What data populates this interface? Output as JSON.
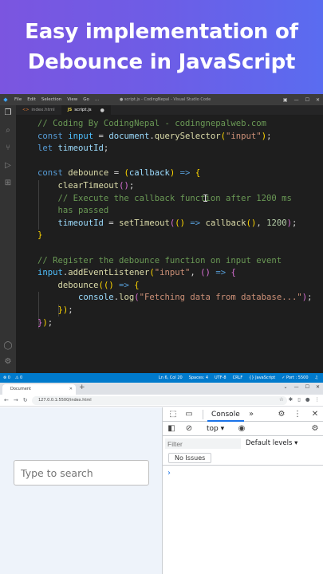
{
  "banner": {
    "line1": "Easy implementation of",
    "line2": "Debounce in JavaScript"
  },
  "vscode": {
    "menu": [
      "File",
      "Edit",
      "Selection",
      "View",
      "Go",
      "..."
    ],
    "window_title": "● script.js - CodingNepal - Visual Studio Code",
    "tabs": [
      {
        "label": "index.html",
        "badge": "<>"
      },
      {
        "label": "script.js",
        "badge": "JS",
        "modified": "●"
      }
    ],
    "code_lines": [
      [
        [
          "c-cmt",
          "// Coding By CodingNepal - codingnepalweb.com"
        ]
      ],
      [
        [
          "c-kw",
          "const "
        ],
        [
          "c-var",
          "input"
        ],
        [
          "c-pun",
          " = "
        ],
        [
          "c-prop",
          "document"
        ],
        [
          "c-pun",
          "."
        ],
        [
          "c-fn",
          "querySelector"
        ],
        [
          "c-brk",
          "("
        ],
        [
          "c-str",
          "\"input\""
        ],
        [
          "c-brk",
          ")"
        ],
        [
          "c-pun",
          ";"
        ]
      ],
      [
        [
          "c-kw",
          "let "
        ],
        [
          "c-prop",
          "timeoutId"
        ],
        [
          "c-pun",
          ";"
        ]
      ],
      [],
      [
        [
          "c-kw",
          "const "
        ],
        [
          "c-fn",
          "debounce"
        ],
        [
          "c-pun",
          " = "
        ],
        [
          "c-brk",
          "("
        ],
        [
          "c-prop",
          "callback"
        ],
        [
          "c-brk",
          ")"
        ],
        [
          "c-pun",
          " "
        ],
        [
          "c-kw",
          "=>"
        ],
        [
          "c-pun",
          " "
        ],
        [
          "c-brk",
          "{"
        ]
      ],
      [
        [
          "c-pun",
          "    "
        ],
        [
          "c-fn",
          "clearTimeout"
        ],
        [
          "c-brk2",
          "("
        ],
        [
          "c-brk2",
          ")"
        ],
        [
          "c-pun",
          ";"
        ]
      ],
      [
        [
          "c-pun",
          "    "
        ],
        [
          "c-cmt",
          "// Execute the callback function after 1200 ms"
        ]
      ],
      [
        [
          "c-pun",
          "    "
        ],
        [
          "c-cmt",
          "has passed"
        ]
      ],
      [
        [
          "c-pun",
          "    "
        ],
        [
          "c-prop",
          "timeoutId"
        ],
        [
          "c-pun",
          " = "
        ],
        [
          "c-fn",
          "setTimeout"
        ],
        [
          "c-brk2",
          "("
        ],
        [
          "c-brk",
          "("
        ],
        [
          "c-brk",
          ")"
        ],
        [
          "c-pun",
          " "
        ],
        [
          "c-kw",
          "=>"
        ],
        [
          "c-pun",
          " "
        ],
        [
          "c-fn",
          "callback"
        ],
        [
          "c-brk",
          "("
        ],
        [
          "c-brk",
          ")"
        ],
        [
          "c-pun",
          ", "
        ],
        [
          "c-num",
          "1200"
        ],
        [
          "c-brk2",
          ")"
        ],
        [
          "c-pun",
          ";"
        ]
      ],
      [
        [
          "c-brk",
          "}"
        ]
      ],
      [],
      [
        [
          "c-cmt",
          "// Register the debounce function on input event"
        ]
      ],
      [
        [
          "c-var",
          "input"
        ],
        [
          "c-pun",
          "."
        ],
        [
          "c-fn",
          "addEventListener"
        ],
        [
          "c-brk",
          "("
        ],
        [
          "c-str",
          "\"input\""
        ],
        [
          "c-pun",
          ", "
        ],
        [
          "c-brk2",
          "("
        ],
        [
          "c-brk2",
          ")"
        ],
        [
          "c-pun",
          " "
        ],
        [
          "c-kw",
          "=>"
        ],
        [
          "c-pun",
          " "
        ],
        [
          "c-brk2",
          "{"
        ]
      ],
      [
        [
          "c-pun",
          "    "
        ],
        [
          "c-fn",
          "debounce"
        ],
        [
          "c-brk",
          "("
        ],
        [
          "c-brk",
          "("
        ],
        [
          "c-brk",
          ")"
        ],
        [
          "c-pun",
          " "
        ],
        [
          "c-kw",
          "=>"
        ],
        [
          "c-pun",
          " "
        ],
        [
          "c-brk",
          "{"
        ]
      ],
      [
        [
          "c-pun",
          "        "
        ],
        [
          "c-prop",
          "console"
        ],
        [
          "c-pun",
          "."
        ],
        [
          "c-fn",
          "log"
        ],
        [
          "c-brk2",
          "("
        ],
        [
          "c-str",
          "\"Fetching data from database...\""
        ],
        [
          "c-brk2",
          ")"
        ],
        [
          "c-pun",
          ";"
        ]
      ],
      [
        [
          "c-pun",
          "    "
        ],
        [
          "c-brk",
          "}"
        ],
        [
          "c-brk",
          ")"
        ],
        [
          "c-pun",
          ";"
        ]
      ],
      [
        [
          "c-brk2",
          "}"
        ],
        [
          "c-brk",
          ")"
        ],
        [
          "c-pun",
          ";"
        ]
      ]
    ],
    "status_left": [
      "⊗ 0",
      "⚠ 0"
    ],
    "status_right": [
      "Ln 6, Col 20",
      "Spaces: 4",
      "UTF-8",
      "CRLF",
      "{} JavaScript",
      "✓ Port : 5500",
      "♫"
    ]
  },
  "browser": {
    "tab_title": "Document",
    "url": "127.0.0.1:5500/index.html",
    "search_placeholder": "Type to search",
    "devtools": {
      "tab": "Console",
      "context": "top",
      "filter_placeholder": "Filter",
      "levels": "Default levels",
      "issues": "No Issues",
      "prompt": "›"
    }
  }
}
